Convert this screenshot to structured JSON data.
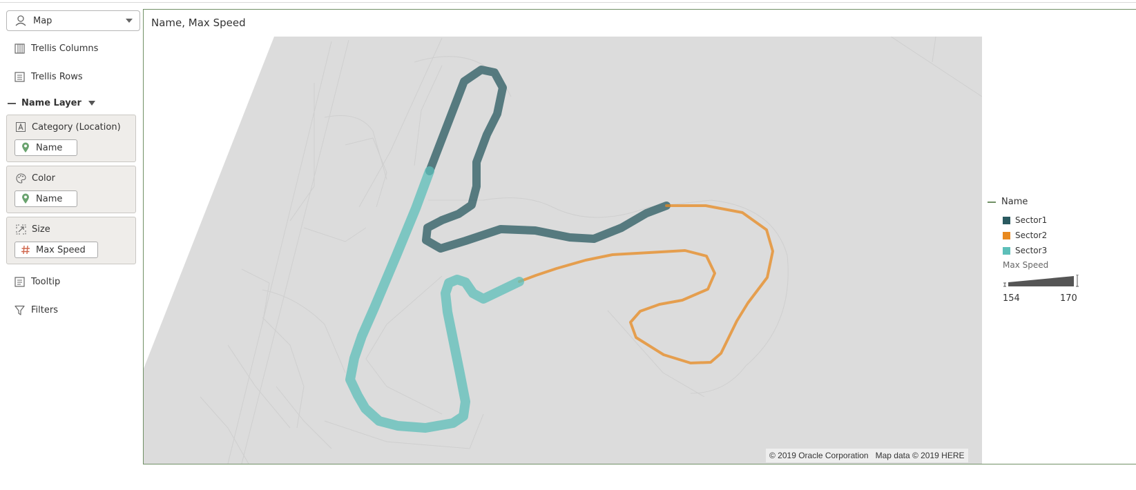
{
  "visualization_picker": {
    "label": "Map",
    "icon": "map-pin-icon"
  },
  "grammar": {
    "trellis_columns": "Trellis Columns",
    "trellis_rows": "Trellis Rows",
    "layer_name": "Name Layer",
    "category": {
      "label": "Category (Location)",
      "pill": "Name"
    },
    "color": {
      "label": "Color",
      "pill": "Name"
    },
    "size": {
      "label": "Size",
      "pill": "Max Speed"
    },
    "tooltip": "Tooltip",
    "filters": "Filters"
  },
  "canvas": {
    "title": "Name, Max Speed"
  },
  "map": {
    "copyright": "© 2019 Oracle Corporation",
    "map_data": "Map data © 2019 HERE",
    "background_color": "#dcdcdc"
  },
  "legend": {
    "color_title": "Name",
    "items": [
      {
        "label": "Sector1",
        "color": "#2a5a60"
      },
      {
        "label": "Sector2",
        "color": "#e8891f"
      },
      {
        "label": "Sector3",
        "color": "#5dbfb9"
      }
    ],
    "size_title": "Max Speed",
    "size_min": "154",
    "size_max": "170"
  }
}
